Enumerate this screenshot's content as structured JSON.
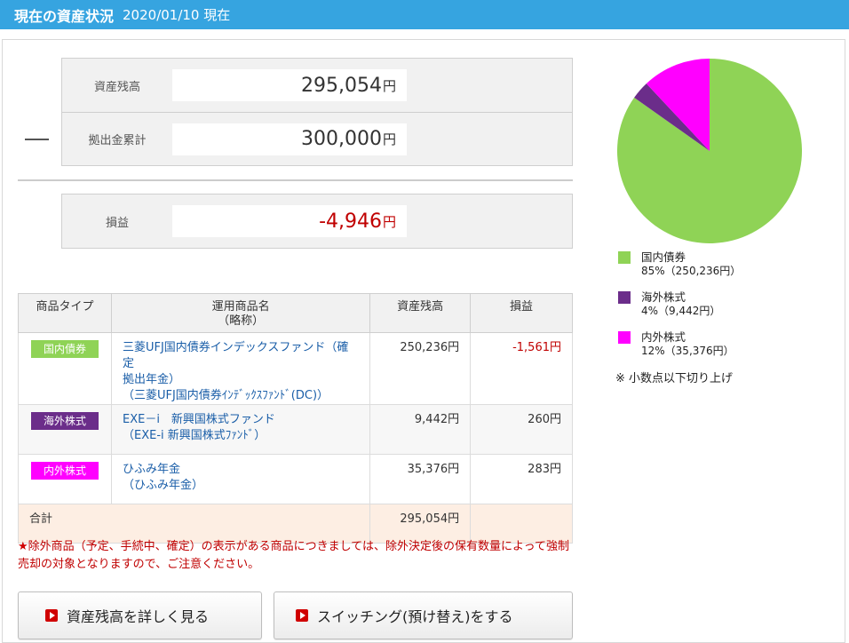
{
  "header": {
    "title": "現在の資産状況",
    "date": "2020/01/10 現在"
  },
  "summary": {
    "balance_label": "資産残高",
    "balance_value": "295,054",
    "balance_unit": "円",
    "contrib_label": "拠出金累計",
    "contrib_value": "300,000",
    "contrib_unit": "円",
    "pl_label": "損益",
    "pl_value": "-4,946",
    "pl_unit": "円"
  },
  "table": {
    "headers": [
      "商品タイプ",
      "運用商品名",
      "（略称）",
      "資産残高",
      "損益"
    ],
    "rows": [
      {
        "type": "国内債券",
        "type_color": "#8fd356",
        "fund_line1": "三菱UFJ国内債券インデックスファンド（確定",
        "fund_line2": "拠出年金）",
        "fund_line3": "（三菱UFJ国内債券ｲﾝﾃﾞｯｸｽﾌｧﾝﾄﾞ(DC)）",
        "balance": "250,236円",
        "pl": "-1,561円"
      },
      {
        "type": "海外株式",
        "type_color": "#6b2d8a",
        "fund_line1": "EXE－i　新興国株式ファンド",
        "fund_line2": "（EXE-i 新興国株式ﾌｧﾝﾄﾞ）",
        "balance": "9,442円",
        "pl": "260円"
      },
      {
        "type": "内外株式",
        "type_color": "#ff00ff",
        "fund_line1": "ひふみ年金",
        "fund_line2": "（ひふみ年金）",
        "balance": "35,376円",
        "pl": "283円"
      }
    ],
    "total_label": "合計",
    "total_balance": "295,054円"
  },
  "notice": {
    "star": "★",
    "text": "除外商品（予定、手続中、確定）の表示がある商品につきましては、除外決定後の保有数量によって強制売却の対象となりますので、ご注意ください。"
  },
  "buttons": {
    "detail": "資産残高を詳しく見る",
    "switch": "スイッチング(預け替え)をする"
  },
  "chart_data": {
    "type": "pie",
    "slices": [
      {
        "label": "国内債券",
        "percent": 85,
        "value": 250236,
        "sub": "85%（250,236円）",
        "color": "#8fd356"
      },
      {
        "label": "海外株式",
        "percent": 4,
        "value": 9442,
        "sub": "4%（9,442円）",
        "color": "#6b2d8a"
      },
      {
        "label": "内外株式",
        "percent": 12,
        "value": 35376,
        "sub": "12%（35,376円）",
        "color": "#ff00ff"
      }
    ],
    "note": "※ 小数点以下切り上げ"
  }
}
